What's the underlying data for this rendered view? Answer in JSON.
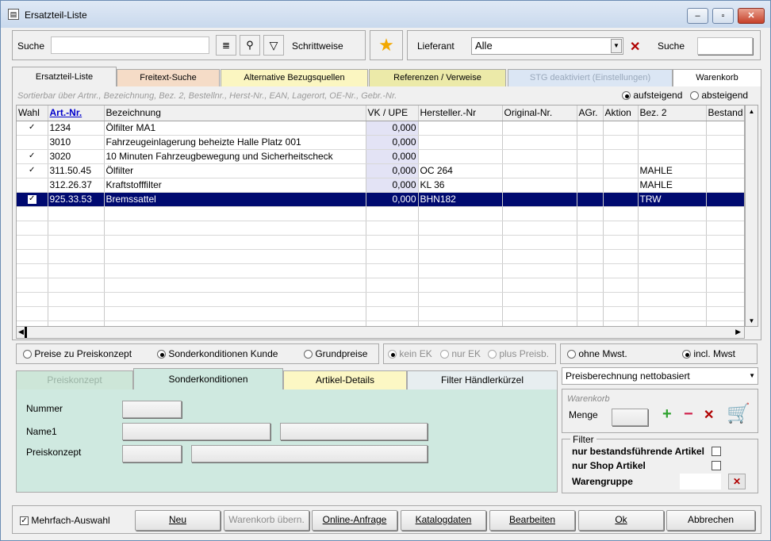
{
  "window": {
    "title": "Ersatzteil-Liste"
  },
  "search": {
    "label": "Suche",
    "mode_label": "Schrittweise",
    "lieferant_label": "Lieferant",
    "lieferant_value": "Alle",
    "suche2_label": "Suche"
  },
  "tabs": [
    "Ersatzteil-Liste",
    "Freitext-Suche",
    "Alternative Bezugsquellen",
    "Referenzen / Verweise",
    "STG deaktiviert (Einstellungen)",
    "Warenkorb"
  ],
  "sort": {
    "hint": "Sortierbar über Artnr., Bezeichnung, Bez. 2, Bestellnr., Herst-Nr., EAN, Lagerort, OE-Nr., Gebr.-Nr.",
    "asc": "aufsteigend",
    "desc": "absteigend"
  },
  "table": {
    "columns": [
      "Wahl",
      "Art.-Nr.",
      "Bezeichnung",
      "VK / UPE",
      "Hersteller.-Nr",
      "Original-Nr.",
      "AGr.",
      "Aktion",
      "Bez. 2",
      "Bestand"
    ],
    "rows": [
      {
        "checked": true,
        "art": "1234",
        "bez": "Ölfilter MA1",
        "vk": "0,000",
        "herst": "",
        "bez2": ""
      },
      {
        "checked": false,
        "art": "3010",
        "bez": "Fahrzeugeinlagerung beheizte Halle Platz 001",
        "vk": "0,000",
        "herst": "",
        "bez2": ""
      },
      {
        "checked": true,
        "art": "3020",
        "bez": "10 Minuten Fahrzeugbewegung und Sicherheitscheck",
        "vk": "0,000",
        "herst": "",
        "bez2": ""
      },
      {
        "checked": true,
        "art": "311.50.45",
        "bez": "Ölfilter",
        "vk": "0,000",
        "herst": "OC 264",
        "bez2": "MAHLE"
      },
      {
        "checked": false,
        "art": "312.26.37",
        "bez": "Kraftstofffilter",
        "vk": "0,000",
        "herst": "KL 36",
        "bez2": "MAHLE"
      },
      {
        "checked": true,
        "art": "925.33.53",
        "bez": "Bremssattel",
        "vk": "0,000",
        "herst": "BHN182",
        "bez2": "TRW"
      }
    ]
  },
  "price_opts": {
    "preise": "Preise zu Preiskonzept",
    "sonder": "Sonderkonditionen Kunde",
    "grund": "Grundpreise",
    "kein_ek": "kein EK",
    "nur_ek": "nur EK",
    "plus": "plus Preisb.",
    "ohne": "ohne Mwst.",
    "incl": "incl. Mwst"
  },
  "lower_tabs": [
    "Preiskonzept",
    "Sonderkonditionen",
    "Artikel-Details",
    "Filter Händlerkürzel"
  ],
  "form": {
    "nummer": "Nummer",
    "name1": "Name1",
    "preiskonzept": "Preiskonzept"
  },
  "right": {
    "preisberechnung": "Preisberechnung nettobasiert",
    "warenkorb": "Warenkorb",
    "menge": "Menge",
    "filter": "Filter",
    "f1": "nur bestandsführende Artikel",
    "f2": "nur Shop Artikel",
    "f3": "Warengruppe"
  },
  "bottom": {
    "mehrfach": "Mehrfach-Auswahl",
    "neu": "Neu",
    "warenkorb": "Warenkorb übern.",
    "online": "Online-Anfrage",
    "katalog": "Katalogdaten",
    "bearbeiten": "Bearbeiten",
    "ok": "Ok",
    "abbrechen": "Abbrechen"
  }
}
